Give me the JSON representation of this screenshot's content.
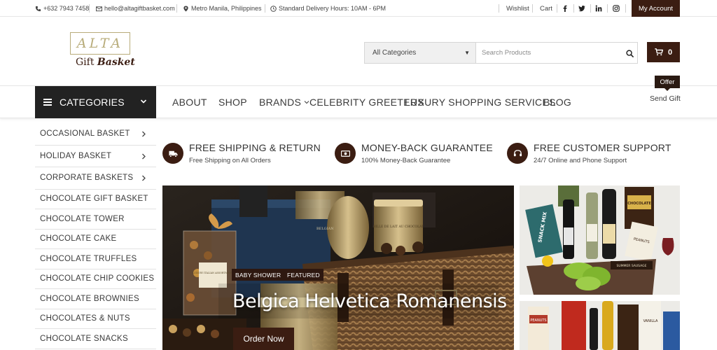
{
  "topbar": {
    "phone": "+632 7943 7458",
    "email": "hello@altagiftbasket.com",
    "location": "Metro Manila, Philippines",
    "delivery_hours": "Standard Delivery Hours: 10AM - 6PM",
    "wishlist": "Wishlist",
    "cart": "Cart",
    "social_icons": [
      "facebook-icon",
      "twitter-icon",
      "linkedin-icon",
      "instagram-icon"
    ],
    "my_account": "My Account"
  },
  "logo": {
    "main": "ALTA",
    "sub_gift": "Gift",
    "sub_basket": "Basket"
  },
  "search": {
    "category_selected": "All Categories",
    "placeholder": "Search Products",
    "cart_count": "0"
  },
  "nav": {
    "categories_label": "CATEGORIES",
    "items": [
      "ABOUT",
      "SHOP",
      "BRANDS",
      "CELEBRITY GREETERS",
      "LUXURY SHOPPING SERVICES",
      "BLOG"
    ],
    "offer_badge": "Offer",
    "send_gift": "Send Gift"
  },
  "sidebar": {
    "items": [
      "OCCASIONAL BASKET",
      "HOLIDAY BASKET",
      "CORPORATE BASKETS",
      "CHOCOLATE GIFT BASKET",
      "CHOCOLATE TOWER",
      "CHOCOLATE CAKE",
      "CHOCOLATE TRUFFLES",
      "CHOCOLATE CHIP COOKIES",
      "CHOCOLATE BROWNIES",
      "CHOCOLATES & NUTS",
      "CHOCOLATE SNACKS"
    ]
  },
  "features": [
    {
      "title": "FREE SHIPPING & RETURN",
      "subtitle": "Free Shipping on All Orders",
      "icon": "truck-icon"
    },
    {
      "title": "MONEY-BACK GUARANTEE",
      "subtitle": "100% Money-Back Guarantee",
      "icon": "money-icon"
    },
    {
      "title": "FREE CUSTOMER SUPPORT",
      "subtitle": "24/7 Online and Phone Support",
      "icon": "headset-icon"
    }
  ],
  "hero": {
    "tags": [
      "BABY SHOWER",
      "FEATURED"
    ],
    "title": "Belgica Helvetica Romanensis",
    "button": "Order Now",
    "image_text": {
      "box_label": "LUXURY ITALIAN ASSORTMENT",
      "tin_label": "BILLE DE LAIT AU CHOCOLAT",
      "belgian_label": "BELGIAN"
    }
  },
  "side_images": {
    "top_labels": [
      "SNACK MIX",
      "PEANUTS",
      "CHOCOLATE",
      "SUMMER SAUSAGE"
    ],
    "bottom_labels": [
      "PEANUTS",
      "VANILLA"
    ]
  },
  "colors": {
    "brand": "#3b1d12",
    "category_button": "#222222",
    "logo_gold": "#b8ac7a"
  }
}
